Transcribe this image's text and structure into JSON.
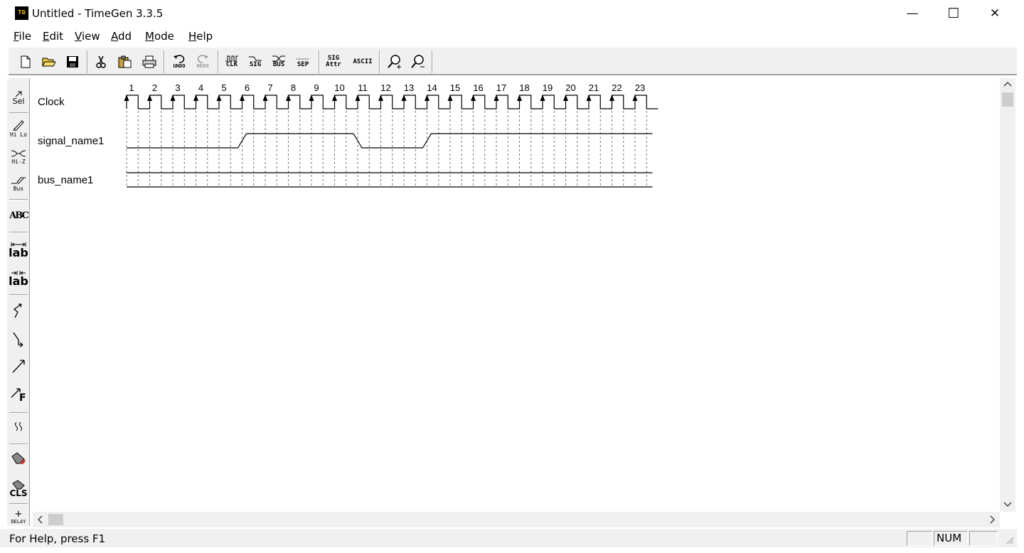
{
  "window": {
    "title": "Untitled - TimeGen 3.3.5",
    "icon_text": "TG",
    "minimize": "—",
    "maximize": "☐",
    "close": "✕"
  },
  "menu": {
    "items": [
      {
        "pre": "",
        "key": "F",
        "post": "ile"
      },
      {
        "pre": "",
        "key": "E",
        "post": "dit"
      },
      {
        "pre": "",
        "key": "V",
        "post": "iew"
      },
      {
        "pre": "",
        "key": "A",
        "post": "dd"
      },
      {
        "pre": "",
        "key": "M",
        "post": "ode"
      },
      {
        "pre": "",
        "key": "H",
        "post": "elp"
      }
    ]
  },
  "toolbar": {
    "undo": "UNDO",
    "redo": "REDO",
    "clk": "CLK",
    "sig": "SIG",
    "bus": "BUS",
    "sep": "SEP",
    "sig_attr_1": "SIG",
    "sig_attr_2": "Attr",
    "ascii": "ASCII"
  },
  "left_tools": {
    "sel": "Sel",
    "hilo": "Hi Lo",
    "hiz": "Hi-Z",
    "bus": "Bus",
    "abc": "ABC",
    "lab1": "lab",
    "lab2": "lab",
    "ff": "F",
    "cls": "CLS",
    "delay": "DELAY"
  },
  "diagram": {
    "cycles": [
      "1",
      "2",
      "3",
      "4",
      "5",
      "6",
      "7",
      "8",
      "9",
      "10",
      "11",
      "12",
      "13",
      "14",
      "15",
      "16",
      "17",
      "18",
      "19",
      "20",
      "21",
      "22",
      "23"
    ],
    "signals": [
      {
        "name": "Clock",
        "type": "clock"
      },
      {
        "name": "signal_name1",
        "type": "signal",
        "levels": [
          0,
          0,
          0,
          0,
          0,
          1,
          1,
          1,
          1,
          1,
          0,
          0,
          0,
          1,
          1,
          1,
          1,
          1,
          1,
          1,
          1,
          1,
          1
        ]
      },
      {
        "name": "bus_name1",
        "type": "bus"
      }
    ]
  },
  "status": {
    "help_text": "For Help, press F1",
    "num": "NUM"
  }
}
